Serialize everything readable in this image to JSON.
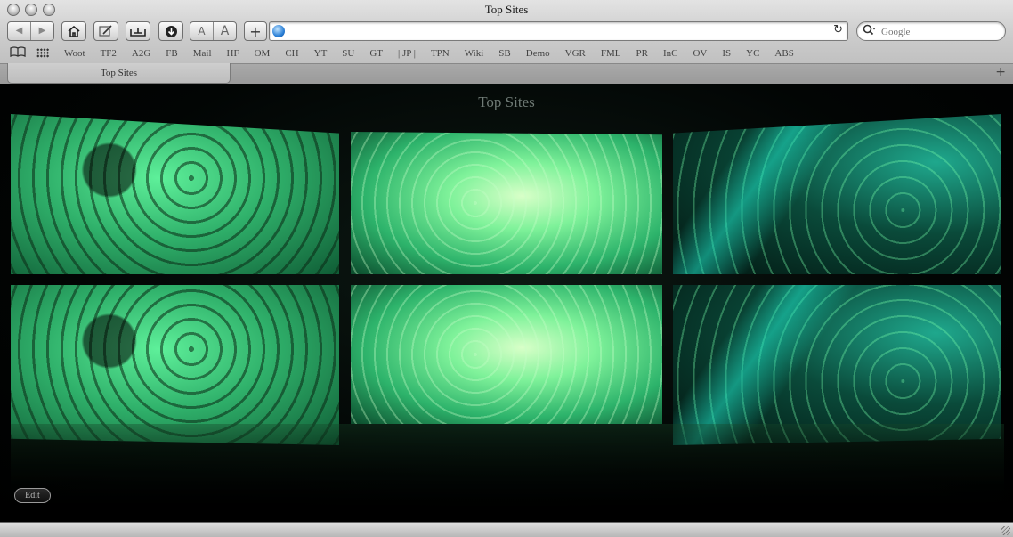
{
  "window": {
    "title": "Top Sites"
  },
  "toolbar": {
    "back_glyph": "◀",
    "forward_glyph": "▶",
    "home_icon": "home-icon",
    "font_small": "A",
    "font_large": "A",
    "add_glyph": "+",
    "address_value": "",
    "reload_glyph": "↻",
    "search_placeholder": "Google",
    "search_glyph": "🔍"
  },
  "bookmarks": [
    "Woot",
    "TF2",
    "A2G",
    "FB",
    "Mail",
    "HF",
    "OM",
    "CH",
    "YT",
    "SU",
    "GT",
    "| JP |",
    "TPN",
    "Wiki",
    "SB",
    "Demo",
    "VGR",
    "FML",
    "PR",
    "InC",
    "OV",
    "IS",
    "YC",
    "ABS"
  ],
  "tabs": [
    {
      "label": "Top Sites",
      "active": true
    }
  ],
  "new_tab_glyph": "+",
  "content": {
    "title": "Top Sites",
    "edit_label": "Edit"
  },
  "colors": {
    "accent": "#4fe08c",
    "chrome": "#c8c8c8"
  }
}
